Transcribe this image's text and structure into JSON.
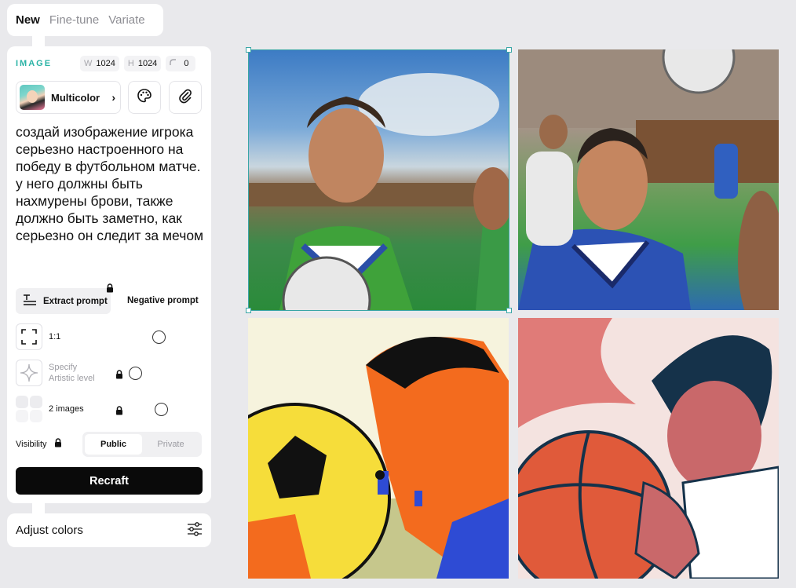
{
  "tabs": [
    "New",
    "Fine-tune",
    "Variate"
  ],
  "image_section": {
    "title": "IMAGE",
    "width_label": "W",
    "width_value": "1024",
    "height_label": "H",
    "height_value": "1024",
    "corner_value": "0"
  },
  "style": {
    "name": "Multicolor",
    "chevron": "›"
  },
  "prompt": "создай изображение игрока серьезно настроенного на победу в футбольном матче. у него должны быть нахмурены брови, также должно быть заметно, как серьезно он следит за мечом",
  "extract_prompt_label": "Extract prompt",
  "negative_prompt_label": "Negative prompt",
  "options": {
    "ratio_label": "1:1",
    "artistic_label_line1": "Specify",
    "artistic_label_line2": "Artistic level",
    "images_label": "2 images"
  },
  "visibility": {
    "label": "Visibility",
    "public": "Public",
    "private": "Private"
  },
  "recraft_button": "Recraft",
  "adjust_colors": "Adjust colors",
  "colors": {
    "accent": "#2bb3a6",
    "selection": "#3aa6a6",
    "button": "#0a0a0a"
  }
}
